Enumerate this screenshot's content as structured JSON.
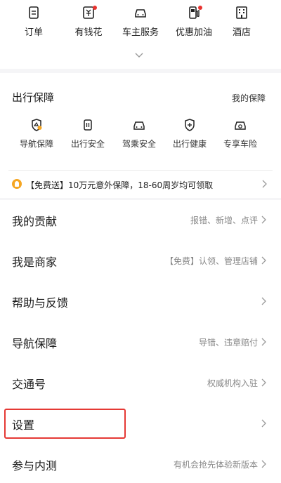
{
  "shortcuts": [
    {
      "label": "订单",
      "icon": "order-icon",
      "badge": false
    },
    {
      "label": "有钱花",
      "icon": "wallet-icon",
      "badge": true
    },
    {
      "label": "车主服务",
      "icon": "car-service-icon",
      "badge": false
    },
    {
      "label": "优惠加油",
      "icon": "fuel-pump-icon",
      "badge": true
    },
    {
      "label": "酒店",
      "icon": "hotel-icon",
      "badge": false
    }
  ],
  "safety": {
    "title": "出行保障",
    "link": "我的保障",
    "items": [
      {
        "label": "导航保障",
        "icon": "nav-shield-icon"
      },
      {
        "label": "出行安全",
        "icon": "travel-safety-icon"
      },
      {
        "label": "驾乘安全",
        "icon": "ride-safety-icon"
      },
      {
        "label": "出行健康",
        "icon": "health-icon"
      },
      {
        "label": "专享车险",
        "icon": "car-insurance-icon"
      }
    ],
    "promo": "【免费送】10万元意外保障，18-60周岁均可领取"
  },
  "menu": [
    {
      "label": "我的贡献",
      "hint": "报错、新增、点评"
    },
    {
      "label": "我是商家",
      "hint": "【免费】认领、管理店铺"
    },
    {
      "label": "帮助与反馈",
      "hint": ""
    },
    {
      "label": "导航保障",
      "hint": "导错、违章赔付"
    },
    {
      "label": "交通号",
      "hint": "权威机构入驻"
    },
    {
      "label": "设置",
      "hint": ""
    },
    {
      "label": "参与内测",
      "hint": "有机会抢先体验新版本"
    }
  ],
  "colors": {
    "accent": "#e53935",
    "badge": "#e8322f",
    "promo_icon": "#f5a623"
  }
}
